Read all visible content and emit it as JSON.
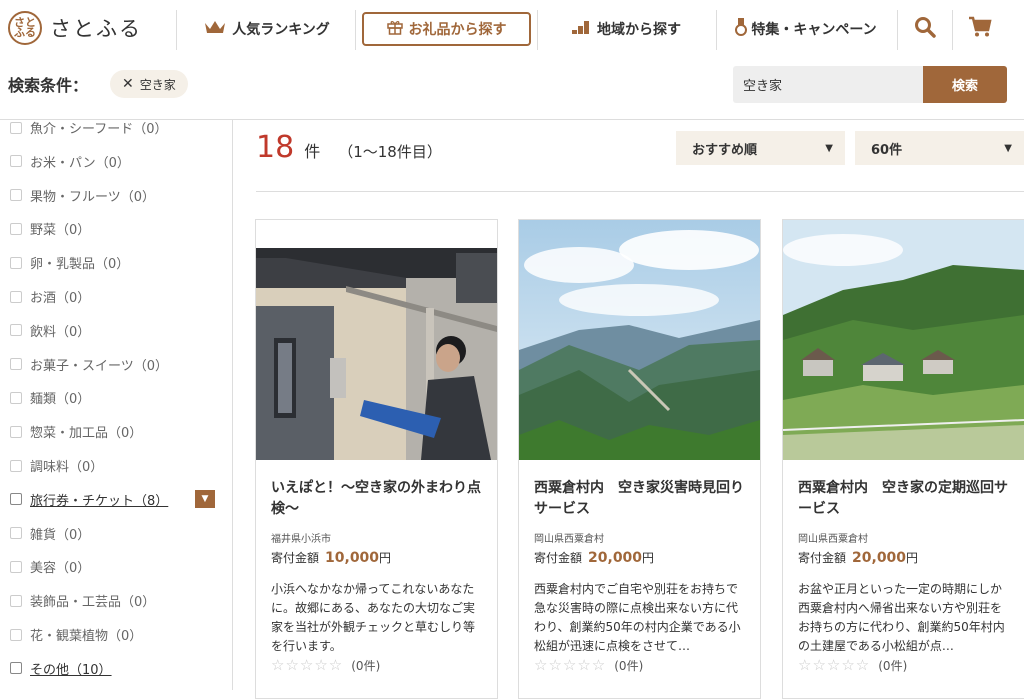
{
  "header": {
    "logo_mark": "さと\nふる",
    "logo_text": "さとふる",
    "nav": [
      {
        "label": "人気ランキング",
        "icon": "crown-icon"
      },
      {
        "label": "お礼品から探す",
        "icon": "gift-icon"
      },
      {
        "label": "地域から探す",
        "icon": "map-steps-icon"
      },
      {
        "label": "特集・キャンペーン",
        "icon": "medal-icon"
      }
    ]
  },
  "conditions": {
    "label": "検索条件：",
    "chip": "空き家"
  },
  "search": {
    "value": "空き家",
    "button": "検索"
  },
  "sidebar": {
    "categories": [
      {
        "label": "魚介・シーフード（0）",
        "active": false
      },
      {
        "label": "お米・パン（0）",
        "active": false
      },
      {
        "label": "果物・フルーツ（0）",
        "active": false
      },
      {
        "label": "野菜（0）",
        "active": false
      },
      {
        "label": "卵・乳製品（0）",
        "active": false
      },
      {
        "label": "お酒（0）",
        "active": false
      },
      {
        "label": "飲料（0）",
        "active": false
      },
      {
        "label": "お菓子・スイーツ（0）",
        "active": false
      },
      {
        "label": "麺類（0）",
        "active": false
      },
      {
        "label": "惣菜・加工品（0）",
        "active": false
      },
      {
        "label": "調味料（0）",
        "active": false
      },
      {
        "label": "旅行券・チケット（8）",
        "active": true
      },
      {
        "label": "雑貨（0）",
        "active": false
      },
      {
        "label": "美容（0）",
        "active": false
      },
      {
        "label": "装飾品・工芸品（0）",
        "active": false
      },
      {
        "label": "花・観葉植物（0）",
        "active": false
      },
      {
        "label": "その他（10）",
        "active": true
      }
    ],
    "expander": "▼"
  },
  "results": {
    "count": "18",
    "unit": "件",
    "range": "（1〜18件目）",
    "sort": "おすすめ順",
    "per_page": "60件"
  },
  "items": [
    {
      "title": "いえぽと！〜空き家の外まわり点検〜",
      "location": "福井県小浜市",
      "price_label": "寄付金額",
      "price": "10,000",
      "yen": "円",
      "desc": "小浜へなかなか帰ってこれないあなたに。故郷にある、あなたの大切なご実家を当社が外観チェックと草むしり等を行います。",
      "reviews": "(0件)"
    },
    {
      "title": "西粟倉村内　空き家災害時見回りサービス",
      "location": "岡山県西粟倉村",
      "price_label": "寄付金額",
      "price": "20,000",
      "yen": "円",
      "desc": "西粟倉村内でご自宅や別荘をお持ちで急な災害時の際に点検出来ない方に代わり、創業約50年の村内企業である小松組が迅速に点検をさせて…",
      "reviews": "(0件)"
    },
    {
      "title": "西粟倉村内　空き家の定期巡回サービス",
      "location": "岡山県西粟倉村",
      "price_label": "寄付金額",
      "price": "20,000",
      "yen": "円",
      "desc": "お盆や正月といった一定の時期にしか西粟倉村内へ帰省出来ない方や別荘をお持ちの方に代わり、創業約50年村内の土建屋である小松組が点…",
      "reviews": "(0件)"
    }
  ],
  "colors": {
    "accent": "#a0673a",
    "count": "#c0392b"
  }
}
